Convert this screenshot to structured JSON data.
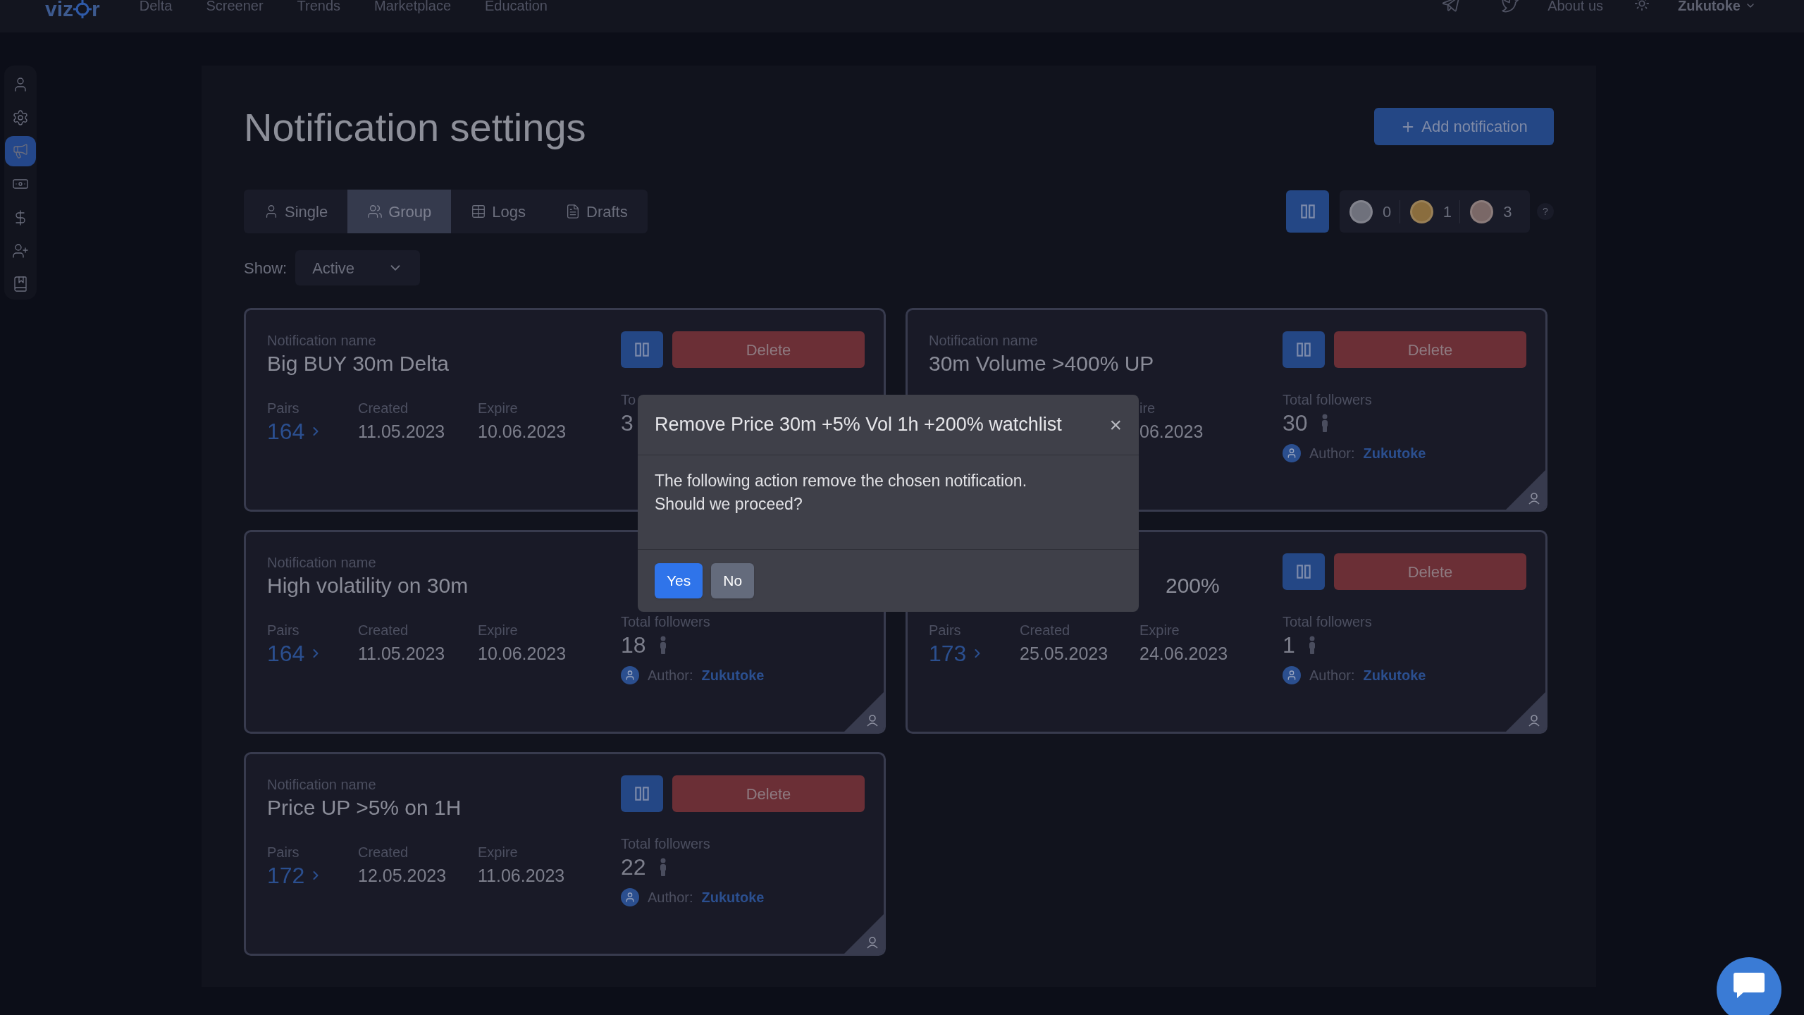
{
  "nav": {
    "logo": [
      "viz",
      "r"
    ],
    "links": [
      "Delta",
      "Screener",
      "Trends",
      "Marketplace",
      "Education"
    ],
    "about": "About us",
    "user": "Zukutoke"
  },
  "sidebar": [
    {
      "kind": "user",
      "selected": false
    },
    {
      "kind": "settings",
      "selected": false
    },
    {
      "kind": "megaphone",
      "selected": true
    },
    {
      "kind": "money",
      "selected": false
    },
    {
      "kind": "dollar",
      "selected": false
    },
    {
      "kind": "user-plus",
      "selected": false
    },
    {
      "kind": "book",
      "selected": false
    }
  ],
  "title": "Notification settings",
  "add_button": "Add notification",
  "tabs": [
    {
      "label": "Single",
      "kind": "user",
      "selected": false
    },
    {
      "label": "Group",
      "kind": "users",
      "selected": true
    },
    {
      "label": "Logs",
      "kind": "table",
      "selected": false
    },
    {
      "label": "Drafts",
      "kind": "file",
      "selected": false
    }
  ],
  "coins": [
    {
      "color": "#6f717c",
      "count": "0"
    },
    {
      "color": "#8a6d3e",
      "count": "1"
    },
    {
      "color": "#7a6867",
      "count": "3"
    }
  ],
  "help": "?",
  "show": {
    "label": "Show:",
    "value": "Active"
  },
  "cards": [
    {
      "label": "Notification name",
      "name": "Big BUY 30m Delta",
      "stats": [
        {
          "kind": "link",
          "label": "Pairs",
          "value": "164"
        },
        {
          "kind": "date",
          "label": "Created",
          "value": "11.05.2023"
        },
        {
          "kind": "date",
          "label": "Expire",
          "value": "10.06.2023"
        }
      ],
      "delete": "Delete",
      "followers": {
        "label": "To",
        "value": "3",
        "figure": false
      },
      "corner": false
    },
    {
      "label": "Notification name",
      "name": "30m Volume >400% UP",
      "stats": [
        {
          "kind": "covered"
        },
        {
          "kind": "covered"
        },
        {
          "kind": "date",
          "label": "ire",
          "value": "06.2023"
        }
      ],
      "delete": "Delete",
      "followers": {
        "label": "Total followers",
        "value": "30",
        "figure": true
      },
      "author": {
        "label": "Author:",
        "name": "Zukutoke"
      },
      "corner": true
    },
    {
      "label": "Notification name",
      "name": "High volatility on 30m",
      "stats": [
        {
          "kind": "link",
          "label": "Pairs",
          "value": "164"
        },
        {
          "kind": "date",
          "label": "Created",
          "value": "11.05.2023"
        },
        {
          "kind": "date",
          "label": "Expire",
          "value": "10.06.2023"
        }
      ],
      "followers": {
        "label": "Total followers",
        "value": "18",
        "figure": true
      },
      "author": {
        "label": "Author:",
        "name": "Zukutoke"
      },
      "corner": true
    },
    {
      "name": "200%",
      "stats": [
        {
          "kind": "link",
          "label": "Pairs",
          "value": "173"
        },
        {
          "kind": "date",
          "label": "Created",
          "value": "25.05.2023"
        },
        {
          "kind": "date",
          "label": "Expire",
          "value": "24.06.2023"
        }
      ],
      "delete": "Delete",
      "followers": {
        "label": "Total followers",
        "value": "1",
        "figure": true
      },
      "author": {
        "label": "Author:",
        "name": "Zukutoke"
      },
      "corner": true
    },
    {
      "label": "Notification name",
      "name": "Price UP >5% on 1H",
      "stats": [
        {
          "kind": "link",
          "label": "Pairs",
          "value": "172"
        },
        {
          "kind": "date",
          "label": "Created",
          "value": "12.05.2023"
        },
        {
          "kind": "date",
          "label": "Expire",
          "value": "11.06.2023"
        }
      ],
      "delete": "Delete",
      "followers": {
        "label": "Total followers",
        "value": "22",
        "figure": true
      },
      "author": {
        "label": "Author:",
        "name": "Zukutoke"
      },
      "corner": true
    }
  ],
  "modal": {
    "title": "Remove Price 30m +5% Vol 1h +200% watchlist",
    "close": "×",
    "message": "The following action remove the chosen notification. Should we proceed?",
    "buttons": [
      {
        "label": "Yes",
        "kind": "primary"
      },
      {
        "label": "No",
        "kind": "secondary"
      }
    ]
  }
}
